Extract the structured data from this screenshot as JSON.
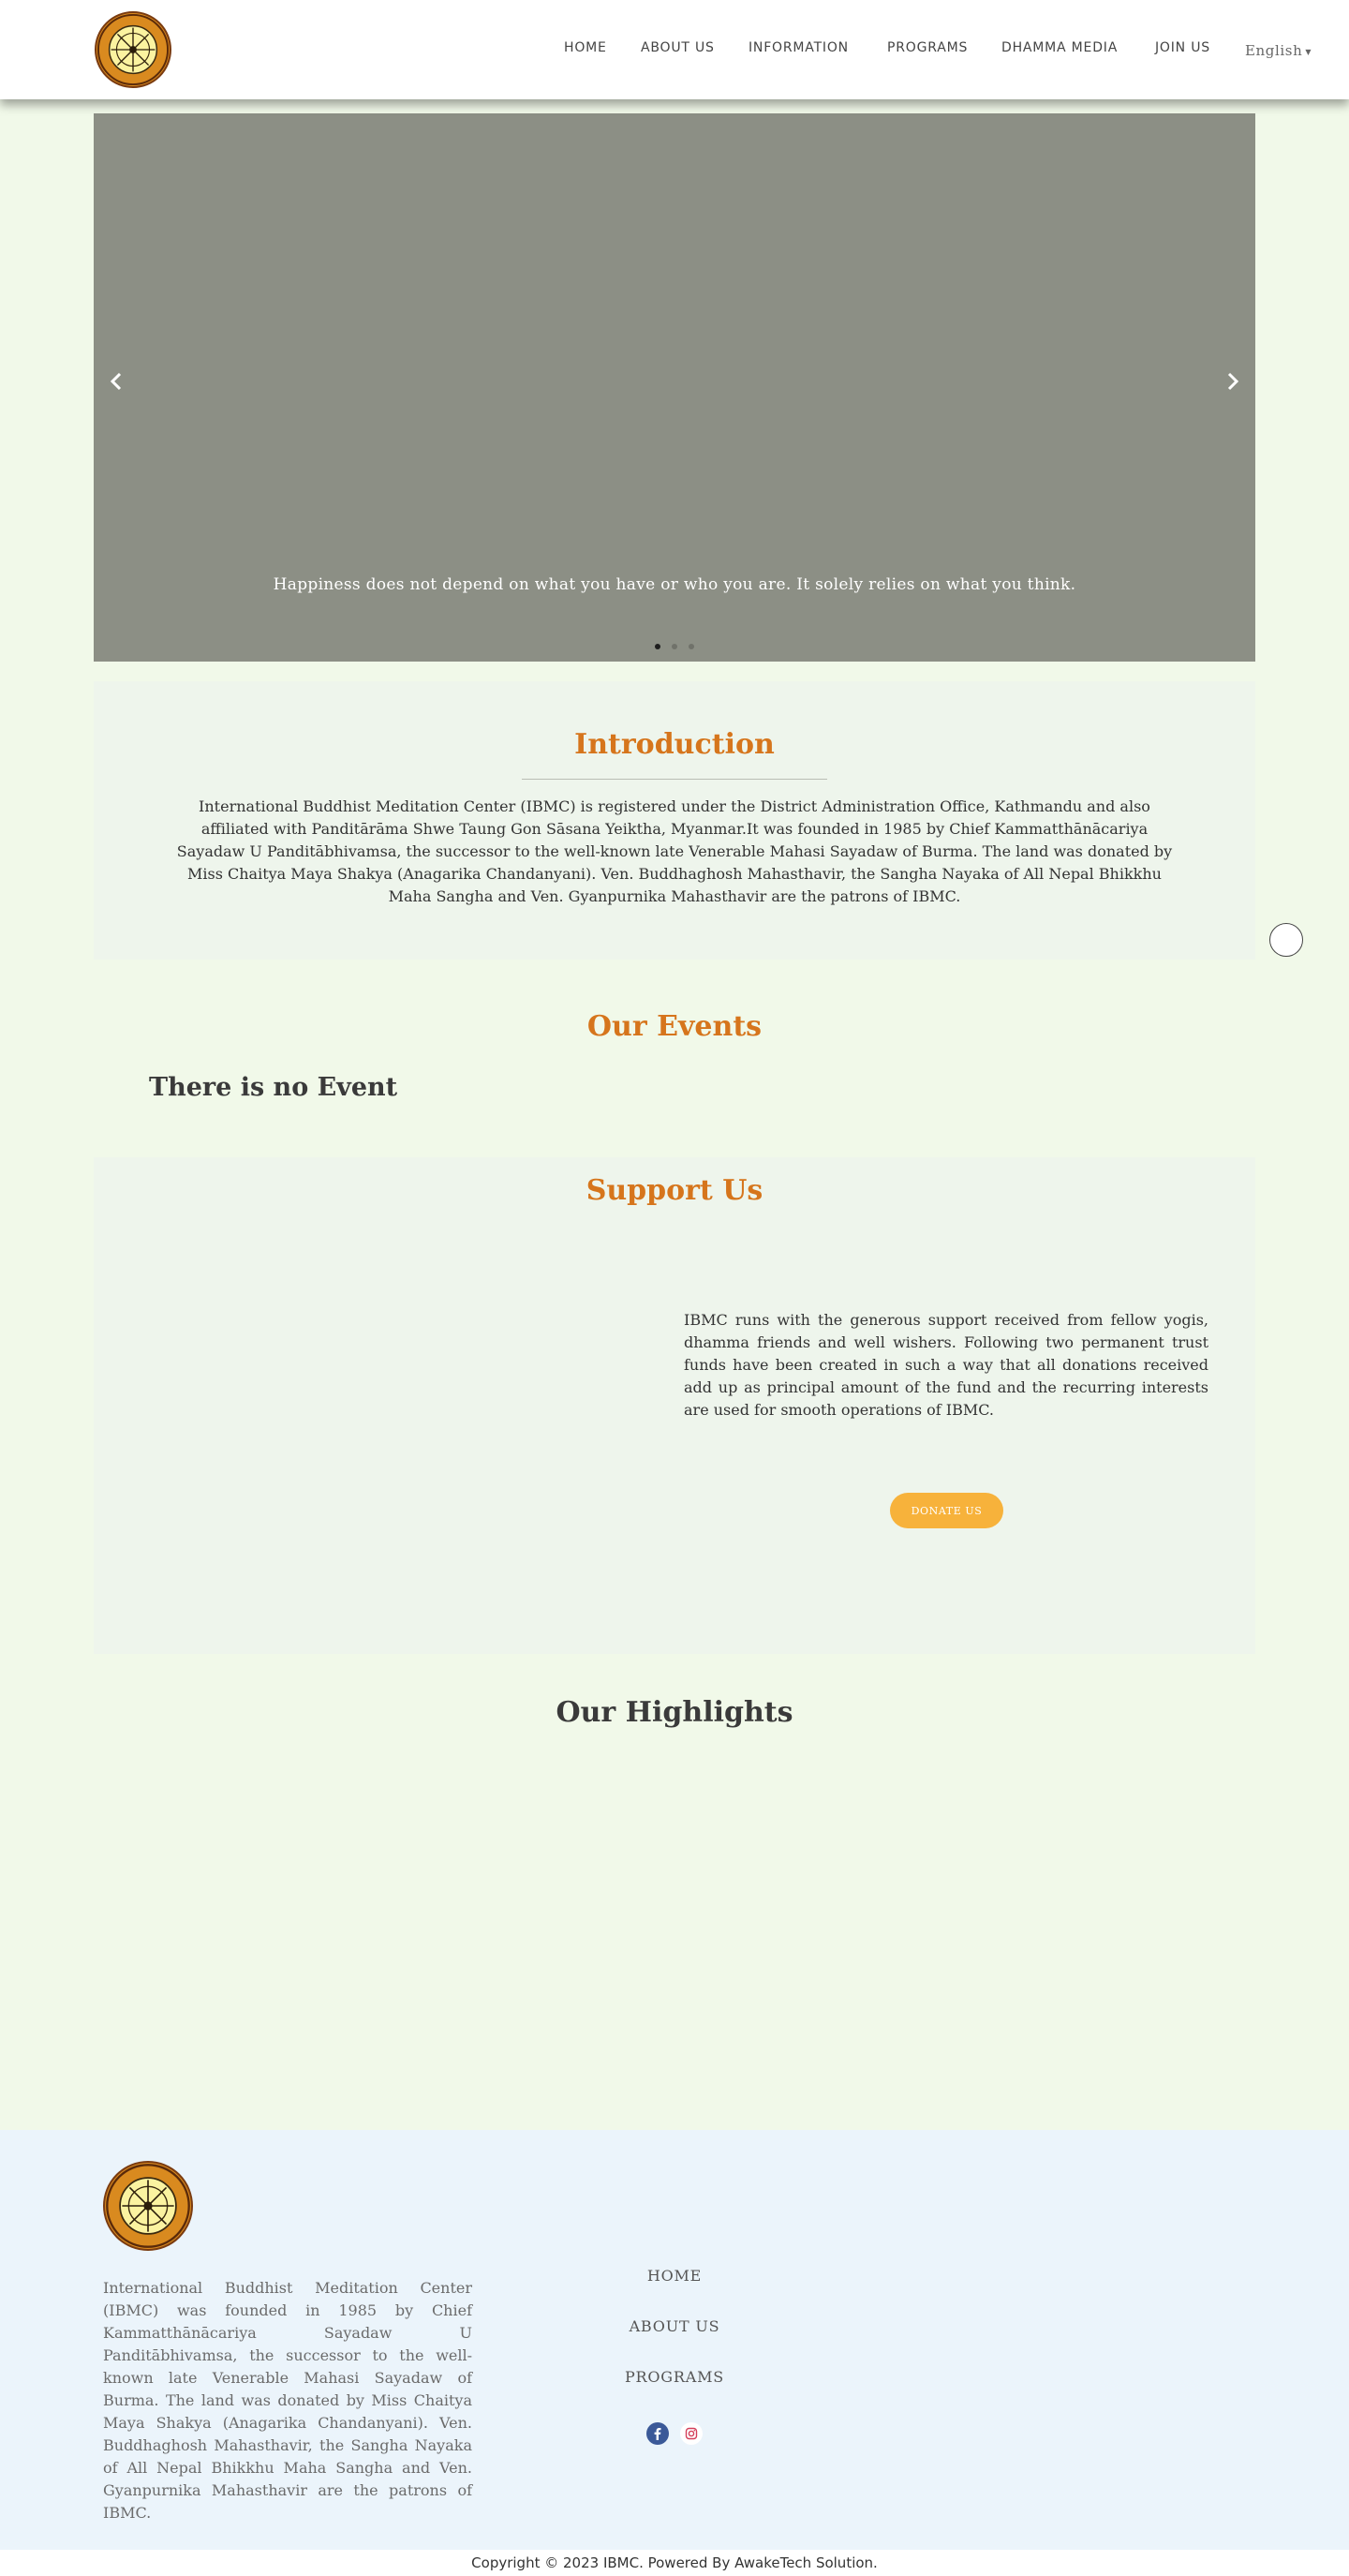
{
  "header": {
    "nav": [
      "HOME",
      "ABOUT US",
      "INFORMATION",
      "PROGRAMS",
      "DHAMMA MEDIA",
      "JOIN US"
    ],
    "language": "English"
  },
  "hero": {
    "caption": "Happiness does not depend on what you have or who you are. It solely relies on what you think.",
    "slide_count": 3,
    "active_slide": 1
  },
  "intro": {
    "title": "Introduction",
    "text": "International Buddhist Meditation Center (IBMC) is registered under the District Administration Office, Kathmandu and also affiliated with Panditārāma Shwe Taung Gon Sāsana Yeiktha, Myanmar.It was founded in 1985 by Chief Kammatthānācariya Sayadaw U Panditābhivamsa, the successor to the well-known late Venerable Mahasi Sayadaw of Burma. The land was donated by Miss Chaitya Maya Shakya (Anagarika Chandanyani). Ven. Buddhaghosh Mahasthavir, the Sangha Nayaka of All Nepal Bhikkhu Maha Sangha and Ven. Gyanpurnika Mahasthavir are the patrons of IBMC."
  },
  "events": {
    "title": "Our Events",
    "empty_text": "There is no Event"
  },
  "support": {
    "title": "Support Us",
    "text": "IBMC runs with the generous support received from fellow yogis, dhamma friends and well wishers. Following two permanent trust funds have been created in such a way that all donations received add up as principal amount of the fund and the recurring interests are used for smooth operations of IBMC.",
    "button": "DONATE US"
  },
  "highlights": {
    "title": "Our Highlights"
  },
  "footer": {
    "text": "International Buddhist Meditation Center (IBMC) was founded in 1985 by Chief Kammatthānācariya Sayadaw U Panditābhivamsa, the successor to the well-known late Venerable Mahasi Sayadaw of Burma. The land was donated by Miss Chaitya Maya Shakya (Anagarika Chandanyani). Ven. Buddhaghosh Mahasthavir, the Sangha Nayaka of All Nepal Bhikkhu Maha Sangha and Ven. Gyanpurnika Mahasthavir are the patrons of IBMC.",
    "links": [
      "HOME",
      "ABOUT US",
      "PROGRAMS"
    ],
    "social": [
      "facebook-icon",
      "instagram-icon"
    ],
    "copyright": "Copyright © 2023 IBMC. Powered By AwakeTech Solution."
  },
  "colors": {
    "accent": "#d6751c",
    "page_bg": "#f1f9e9",
    "section_bg": "#eef5ec",
    "hero_bg": "#8c8f85",
    "donate": "#f7b23b",
    "footer_bg": "#ebf4fb"
  }
}
